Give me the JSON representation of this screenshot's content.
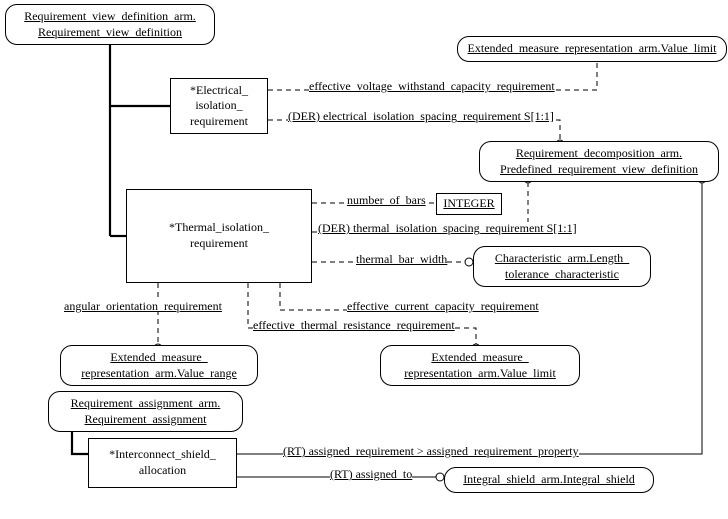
{
  "boxes": {
    "req_view_def": {
      "l1": "Requirement_view_definition_arm.",
      "l2": "Requirement_view_definition"
    },
    "elec_iso": {
      "l1": "*Electrical_",
      "l2": "isolation_",
      "l3": "requirement"
    },
    "ext_val_limit_top": {
      "l1": "Extended_measure_representation_arm.Value_limit"
    },
    "req_decomp": {
      "l1": "Requirement_decomposition_arm.",
      "l2": "Predefined_requirement_view_definition"
    },
    "therm_iso": {
      "l1": "*Thermal_isolation_",
      "l2": "requirement"
    },
    "integer": {
      "l1": "INTEGER"
    },
    "char_len": {
      "l1": "Characteristic_arm.Length_",
      "l2": "tolerance_characteristic"
    },
    "ext_val_range": {
      "l1": "Extended_measure_",
      "l2": "representation_arm.Value_range"
    },
    "ext_val_limit_bot": {
      "l1": "Extended_measure_",
      "l2": "representation_arm.Value_limit"
    },
    "req_assign": {
      "l1": "Requirement_assignment_arm.",
      "l2": "Requirement_assignment"
    },
    "inter_shield": {
      "l1": "*Interconnect_shield_",
      "l2": "allocation"
    },
    "integral_shield": {
      "l1": "Integral_shield_arm.Integral_shield"
    }
  },
  "labels": {
    "eff_volt": "effective_voltage_withstand_capacity_requirement",
    "der_elec": "(DER) electrical_isolation_spacing_requirement S[1:1]",
    "num_bars": "number_of_bars",
    "der_therm": "(DER) thermal_isolation_spacing_requirement S[1:1]",
    "therm_bar_w": "thermal_bar_width",
    "ang_orient": "angular_orientation_requirement",
    "eff_curr": "effective_current_capacity_requirement",
    "eff_therm_res": "effective_thermal_resistance_requirement",
    "rt_assigned_req": "(RT) assigned_requirement > assigned_requirement_property",
    "rt_assigned_to": "(RT) assigned_to"
  }
}
